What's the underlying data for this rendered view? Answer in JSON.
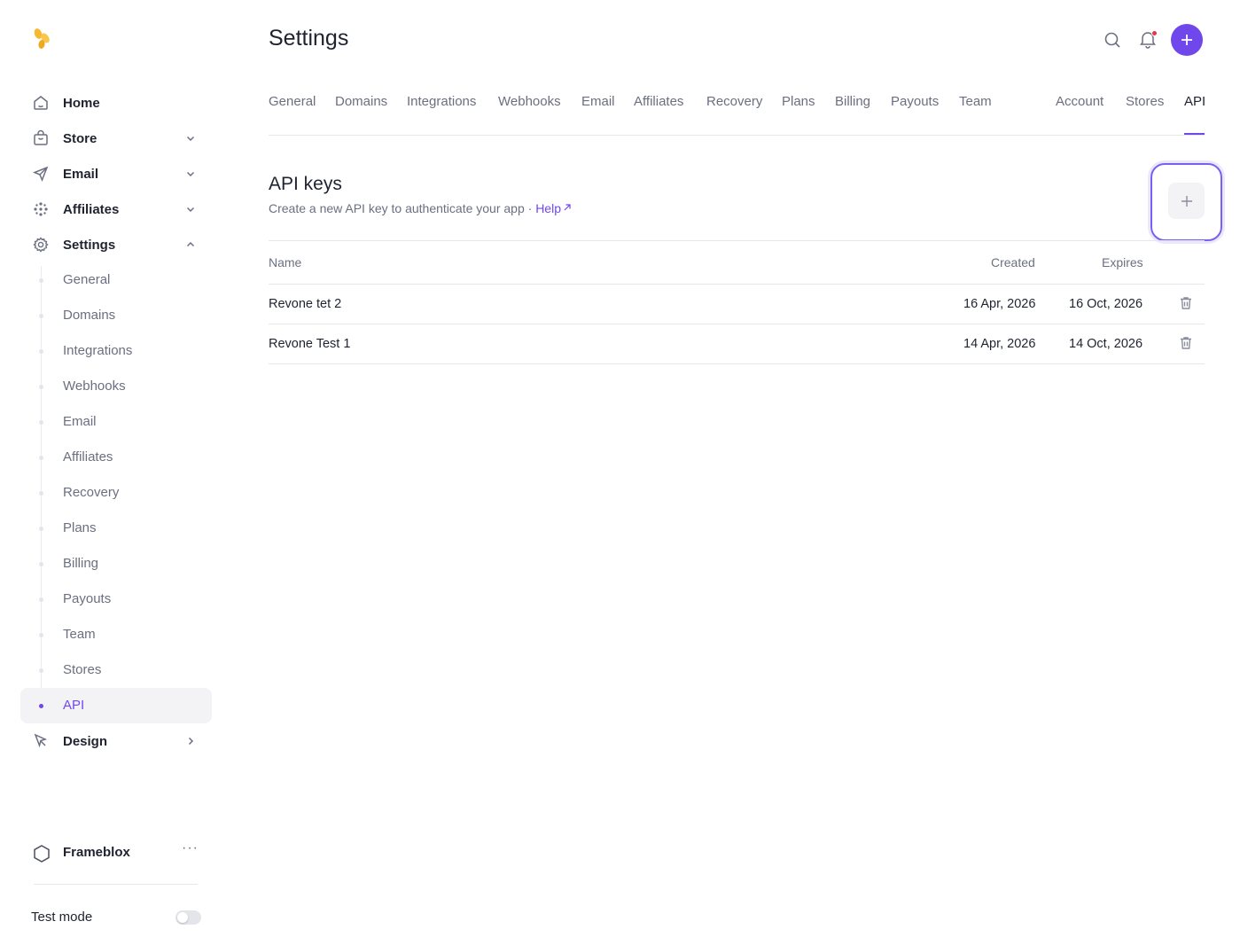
{
  "header": {
    "title": "Settings"
  },
  "sidebar": {
    "nav": [
      {
        "label": "Home",
        "icon": "home-icon"
      },
      {
        "label": "Store",
        "icon": "bag-icon"
      },
      {
        "label": "Email",
        "icon": "send-icon"
      },
      {
        "label": "Affiliates",
        "icon": "affiliates-icon"
      },
      {
        "label": "Settings",
        "icon": "gear-icon"
      }
    ],
    "settings_sub": [
      "General",
      "Domains",
      "Integrations",
      "Webhooks",
      "Email",
      "Affiliates",
      "Recovery",
      "Plans",
      "Billing",
      "Payouts",
      "Team",
      "Stores",
      "API"
    ],
    "active_sub": "API",
    "design": {
      "label": "Design",
      "icon": "cursor-icon"
    },
    "workspace": {
      "name": "Frameblox",
      "more": "···"
    },
    "test_mode": {
      "label": "Test mode",
      "enabled": false
    }
  },
  "tabs": [
    "General",
    "Domains",
    "Integrations",
    "Webhooks",
    "Email",
    "Affiliates",
    "Recovery",
    "Plans",
    "Billing",
    "Payouts",
    "Team",
    "Account",
    "Stores",
    "API"
  ],
  "active_tab": "API",
  "section": {
    "title": "API keys",
    "description": "Create a new API key to authenticate your app · ",
    "help": "Help"
  },
  "table": {
    "headers": {
      "name": "Name",
      "created": "Created",
      "expires": "Expires"
    },
    "rows": [
      {
        "name": "Revone tet 2",
        "created": "16 Apr, 2026",
        "expires": "16 Oct, 2026"
      },
      {
        "name": "Revone Test 1",
        "created": "14 Apr, 2026",
        "expires": "14 Oct, 2026"
      }
    ]
  },
  "colors": {
    "accent": "#7047eb",
    "notification": "#e5374c",
    "logo": "#f5b82e"
  }
}
